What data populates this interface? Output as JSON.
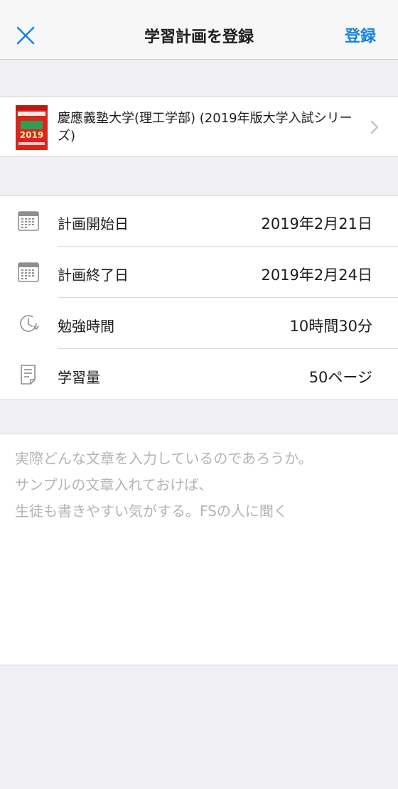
{
  "navbar": {
    "title": "学習計画を登録",
    "close_icon": "close-icon",
    "register_label": "登録",
    "accent_color": "#1a82e2"
  },
  "book": {
    "title": "慶應義塾大学(理工学部) (2019年版大学入試シリーズ)",
    "cover_year": "2019",
    "cover_color": "#d7261d"
  },
  "plan": {
    "rows": [
      {
        "icon": "calendar-icon",
        "label": "計画開始日",
        "value": "2019年2月21日"
      },
      {
        "icon": "calendar-icon",
        "label": "計画終了日",
        "value": "2019年2月24日"
      },
      {
        "icon": "clock-icon",
        "label": "勉強時間",
        "value": "10時間30分"
      },
      {
        "icon": "document-icon",
        "label": "学習量",
        "value": "50ページ"
      }
    ]
  },
  "memo": {
    "text": "実際どんな文章を入力しているのであろうか。\nサンプルの文章入れておけば、\n生徒も書きやすい気がする。FSの人に聞く"
  }
}
